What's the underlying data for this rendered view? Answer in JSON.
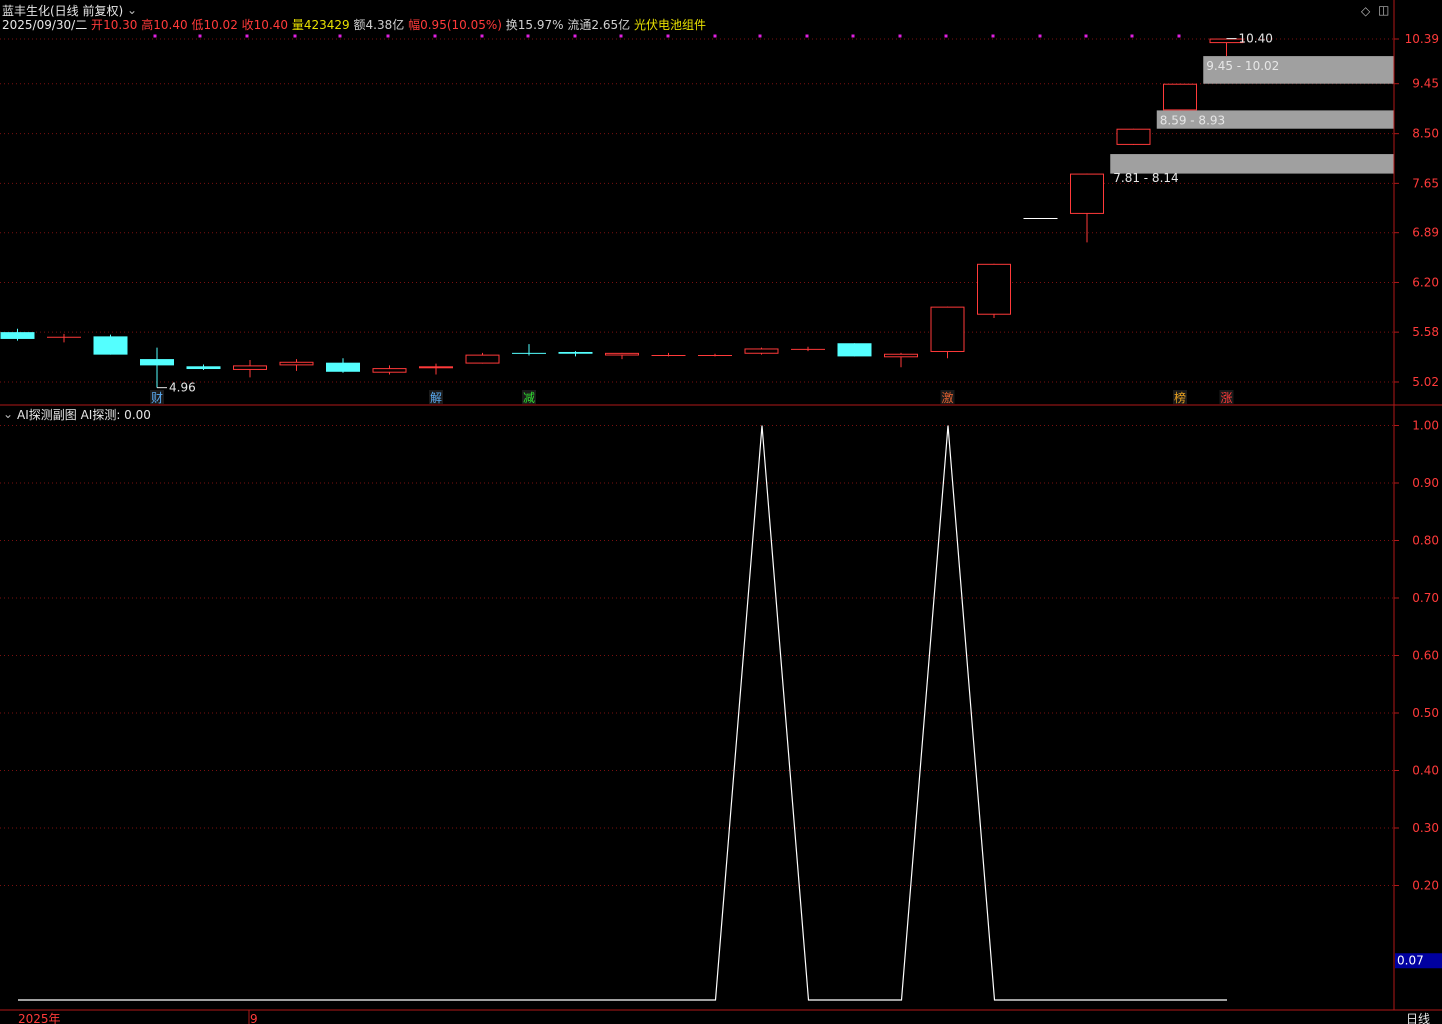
{
  "header": {
    "stock_title": "蓝丰生化(日线 前复权)",
    "date": "2025/09/30/二",
    "open_label": "开",
    "open": "10.30",
    "high_label": "高",
    "high": "10.40",
    "low_label": "低",
    "low": "10.02",
    "close_label": "收",
    "close": "10.40",
    "volume_label": "量",
    "volume": "423429",
    "amount_label": "额",
    "amount": "4.38亿",
    "change_label": "幅",
    "change": "0.95(10.05%)",
    "turnover_label": "换",
    "turnover": "15.97%",
    "float_label": "流通",
    "float": "2.65亿",
    "concept": "光伏电池组件"
  },
  "sub_header": {
    "name": "AI探测副图",
    "indicator": "AI探测: 0.00"
  },
  "footer": {
    "year": "2025年",
    "month": "9",
    "period": "日线"
  },
  "colors": {
    "up": "#ff3a3a",
    "down": "#54ffff",
    "grid": "#7a1010",
    "axis": "#b01818",
    "zone": "#a0a0a0",
    "line": "#ffffff",
    "magenta": "#e020e0"
  },
  "chart_data": [
    {
      "type": "candlestick",
      "y_ticks": [
        "10.39",
        "9.45",
        "8.50",
        "7.65",
        "6.89",
        "6.20",
        "5.58",
        "5.02"
      ],
      "candles": [
        {
          "o": 5.58,
          "h": 5.62,
          "l": 5.48,
          "c": 5.5
        },
        {
          "o": 5.52,
          "h": 5.56,
          "l": 5.46,
          "c": 5.52
        },
        {
          "o": 5.53,
          "h": 5.55,
          "l": 5.32,
          "c": 5.32
        },
        {
          "o": 5.27,
          "h": 5.4,
          "l": 4.96,
          "c": 5.2
        },
        {
          "o": 5.19,
          "h": 5.21,
          "l": 5.15,
          "c": 5.16
        },
        {
          "o": 5.15,
          "h": 5.26,
          "l": 5.07,
          "c": 5.2
        },
        {
          "o": 5.2,
          "h": 5.27,
          "l": 5.14,
          "c": 5.24
        },
        {
          "o": 5.23,
          "h": 5.28,
          "l": 5.12,
          "c": 5.13
        },
        {
          "o": 5.12,
          "h": 5.2,
          "l": 5.1,
          "c": 5.17
        },
        {
          "o": 5.18,
          "h": 5.22,
          "l": 5.1,
          "c": 5.19
        },
        {
          "o": 5.22,
          "h": 5.34,
          "l": 5.22,
          "c": 5.32
        },
        {
          "o": 5.34,
          "h": 5.44,
          "l": 5.31,
          "c": 5.33
        },
        {
          "o": 5.35,
          "h": 5.36,
          "l": 5.3,
          "c": 5.33
        },
        {
          "o": 5.31,
          "h": 5.34,
          "l": 5.27,
          "c": 5.34
        },
        {
          "o": 5.31,
          "h": 5.34,
          "l": 5.3,
          "c": 5.31
        },
        {
          "o": 5.31,
          "h": 5.33,
          "l": 5.3,
          "c": 5.31
        },
        {
          "o": 5.33,
          "h": 5.4,
          "l": 5.32,
          "c": 5.39
        },
        {
          "o": 5.38,
          "h": 5.41,
          "l": 5.36,
          "c": 5.38
        },
        {
          "o": 5.45,
          "h": 5.45,
          "l": 5.3,
          "c": 5.3
        },
        {
          "o": 5.29,
          "h": 5.34,
          "l": 5.18,
          "c": 5.33
        },
        {
          "o": 5.35,
          "h": 5.89,
          "l": 5.28,
          "c": 5.89
        },
        {
          "o": 5.79,
          "h": 6.45,
          "l": 5.75,
          "c": 6.45
        },
        {
          "o": 7.1,
          "h": 7.1,
          "l": 7.1,
          "c": 7.1
        },
        {
          "o": 7.17,
          "h": 7.81,
          "l": 6.75,
          "c": 7.81
        },
        {
          "o": 8.3,
          "h": 8.59,
          "l": 8.3,
          "c": 8.59
        },
        {
          "o": 8.93,
          "h": 9.45,
          "l": 8.93,
          "c": 9.45
        },
        {
          "o": 10.3,
          "h": 10.4,
          "l": 10.02,
          "c": 10.4
        }
      ],
      "gap_zones": [
        {
          "low": 7.81,
          "high": 8.14,
          "label": "7.81 - 8.14"
        },
        {
          "low": 8.59,
          "high": 8.93,
          "label": "8.59 - 8.93"
        },
        {
          "low": 9.45,
          "high": 10.02,
          "label": "9.45 - 10.02"
        }
      ],
      "annotations": [
        {
          "text": "4.96",
          "index": 3,
          "value": 4.96
        },
        {
          "text": "10.40",
          "index": 26,
          "value": 10.4
        }
      ],
      "event_markers": [
        {
          "text": "财",
          "index": 3,
          "color": "#5aaaf0"
        },
        {
          "text": "解",
          "index": 9,
          "color": "#5aaaf0"
        },
        {
          "text": "减",
          "index": 11,
          "color": "#30e030"
        },
        {
          "text": "激",
          "index": 20,
          "color": "#e06030"
        },
        {
          "text": "榜",
          "index": 25,
          "color": "#e6a020"
        },
        {
          "text": "涨",
          "index": 26,
          "color": "#ff3a3a"
        }
      ]
    },
    {
      "type": "line",
      "name": "AI探测",
      "y_ticks": [
        "1.00",
        "0.90",
        "0.80",
        "0.70",
        "0.60",
        "0.50",
        "0.40",
        "0.30",
        "0.20"
      ],
      "current_value": "0.07",
      "points": [
        [
          0,
          0
        ],
        [
          15,
          0
        ],
        [
          16,
          1
        ],
        [
          17,
          0
        ],
        [
          19,
          0
        ],
        [
          20,
          1
        ],
        [
          21,
          0
        ],
        [
          26,
          0
        ]
      ]
    }
  ]
}
